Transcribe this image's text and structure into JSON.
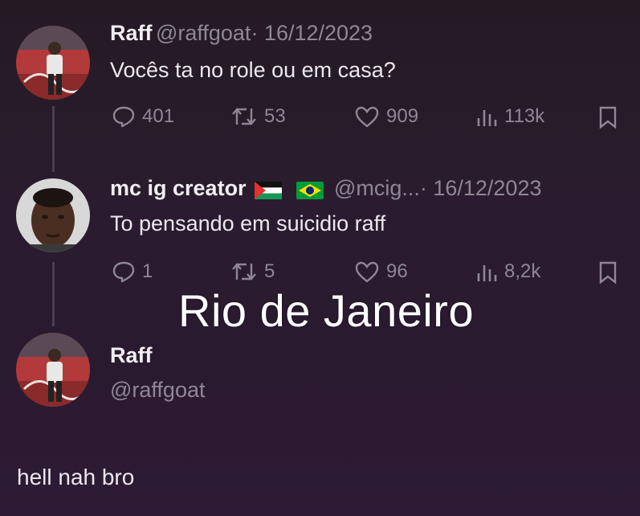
{
  "tweets": [
    {
      "display_name": "Raff",
      "handle": "@raffgoat",
      "date": "· 16/12/2023",
      "text": "Vocês ta no role ou em casa?",
      "metrics": {
        "replies": "401",
        "retweets": "53",
        "likes": "909",
        "views": "113k"
      }
    },
    {
      "display_name": "mc ig creator",
      "handle": "@mcig...",
      "date": "· 16/12/2023",
      "text": "To pensando em suicidio raff",
      "metrics": {
        "replies": "1",
        "retweets": "5",
        "likes": "96",
        "views": "8,2k"
      }
    },
    {
      "display_name": "Raff",
      "handle": "@raffgoat"
    }
  ],
  "overlay_caption": "Rio de Janeiro",
  "reply_text": "hell nah bro",
  "icons": [
    "reply-icon",
    "retweet-icon",
    "like-icon",
    "views-icon",
    "bookmark-icon",
    "palestine-flag-icon",
    "brazil-flag-icon"
  ],
  "colors": {
    "background": "#2a1c2e",
    "muted": "#8e8794",
    "text": "#ece8ee"
  }
}
